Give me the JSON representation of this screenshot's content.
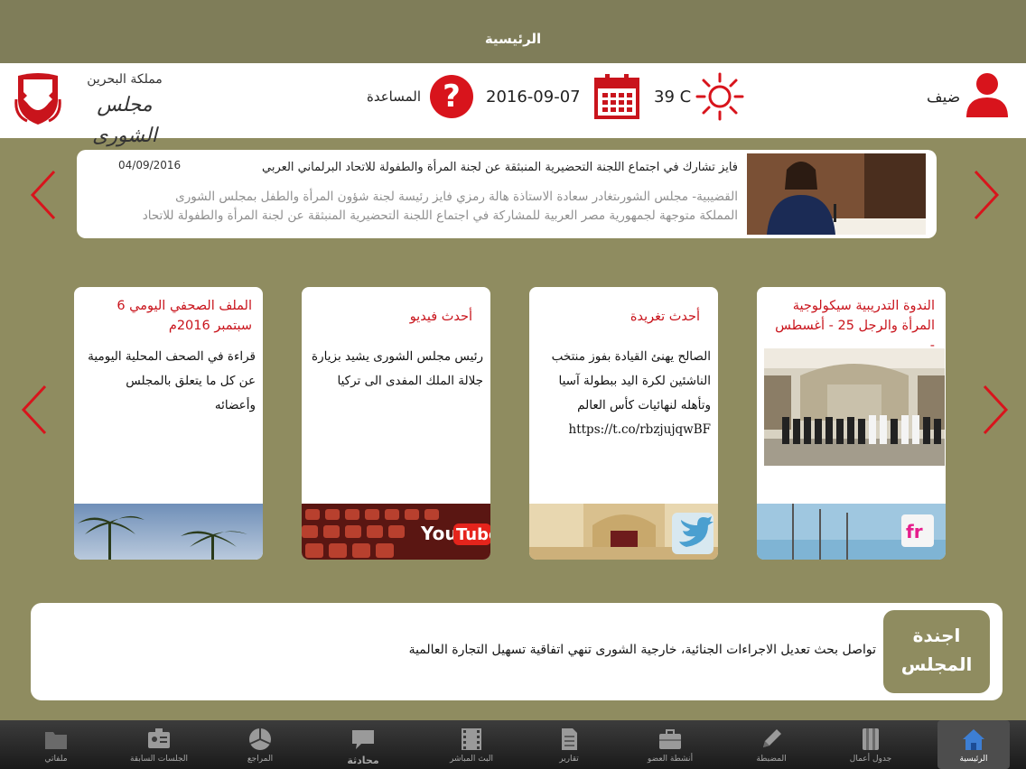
{
  "nav": {
    "title": "الرئيسية"
  },
  "header": {
    "logo_line1": "مملكة البحرين",
    "logo_line2": "مجلس الشورى",
    "help_label": "المساعدة",
    "date": "2016-09-07",
    "temperature": "39 C",
    "user_label": "ضيف"
  },
  "news": {
    "date": "04/09/2016",
    "title": "فايز تشارك في اجتماع اللجنة التحضيرية المنبثقة عن لجنة المرأة والطفولة للاتحاد البرلماني العربي",
    "body_line1": "القضيبية- مجلس الشورىتغادر سعادة الاستاذة هالة رمزي فايز رئيسة لجنة شؤون المرأة والطفل بمجلس الشورى",
    "body_line2": "المملكة متوجهة لجمهورية مصر العربية للمشاركة في اجتماع اللجنة التحضيرية المنبثقة عن لجنة المرأة والطفولة للاتحاد"
  },
  "tiles": [
    {
      "title": "الملف الصحفي اليومي 6 سبتمبر 2016م",
      "text": "قراءة في الصحف المحلية اليومية عن كل ما يتعلق بالمجلس وأعضائه",
      "banner_icon": "palm-trees"
    },
    {
      "title": "أحدث فيديو",
      "text": "رئيس مجلس الشورى يشيد بزيارة جلالة الملك المفدى الى تركيا",
      "banner_icon": "youtube",
      "banner_text_you": "You",
      "banner_text_tube": "Tube"
    },
    {
      "title": "أحدث تغريدة",
      "text": "الصالح يهنئ القيادة بفوز منتخب الناشئين لكرة اليد ببطولة آسيا وتأهله لنهائيات كأس العالم https://t.co/rbzjujqwBF",
      "banner_icon": "twitter"
    },
    {
      "title": "الندوة التدريبية سيكولوجية المرأة والرجل 25 - أغسطس -",
      "banner_icon": "flickr",
      "banner_text": "fr"
    }
  ],
  "agenda": {
    "badge": "اجندة المجلس",
    "text": "تواصل بحث تعديل الاجراءات الجنائية، خارجية الشورى تنهي اتفاقية تسهيل التجارة العالمية"
  },
  "tabs": [
    {
      "label": "الرئيسية",
      "icon": "home-icon",
      "active": true
    },
    {
      "label": "جدول أعمال",
      "icon": "book-icon"
    },
    {
      "label": "المضبطة",
      "icon": "pencil-icon"
    },
    {
      "label": "أنشطة العضو",
      "icon": "briefcase-icon"
    },
    {
      "label": "تقارير",
      "icon": "document-icon"
    },
    {
      "label": "البث المباشر",
      "icon": "film-icon"
    },
    {
      "label": "محادثة",
      "icon": "chat-icon"
    },
    {
      "label": "المراجع",
      "icon": "pie-icon"
    },
    {
      "label": "الجلسات السابقة",
      "icon": "id-card-icon"
    },
    {
      "label": "ملفاتي",
      "icon": "folder-icon"
    }
  ],
  "colors": {
    "accent_red": "#d8141c",
    "olive": "#8f8c60",
    "olive_dark": "#7f7d59"
  }
}
